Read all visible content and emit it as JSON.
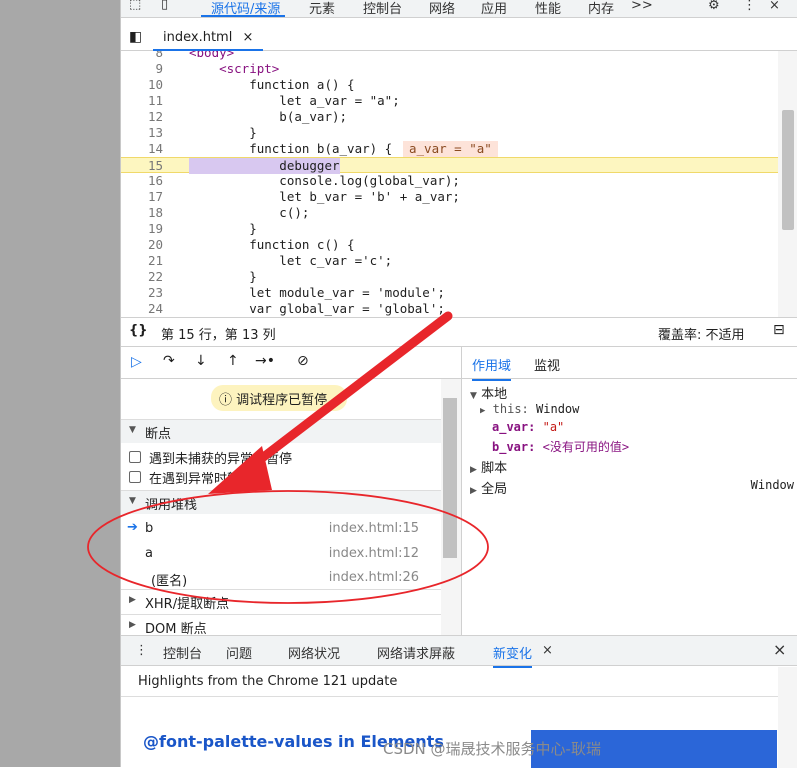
{
  "toptabs": [
    "源代码/来源",
    "元素",
    "控制台",
    "网络",
    "应用",
    "性能",
    "内存"
  ],
  "toptabs_more": ">>",
  "file_tab": "index.html",
  "close_char": "×",
  "code_lines": [
    {
      "n": "8",
      "t": "<body>"
    },
    {
      "n": "9",
      "t": "    <script>"
    },
    {
      "n": "10",
      "t": "        function a() {"
    },
    {
      "n": "11",
      "t": "            let a_var = \"a\";"
    },
    {
      "n": "12",
      "t": "            b(a_var);"
    },
    {
      "n": "13",
      "t": "        }"
    },
    {
      "n": "14",
      "t": "        function b(a_var) {"
    },
    {
      "n": "15",
      "t": "            debugger"
    },
    {
      "n": "16",
      "t": "            console.log(global_var);"
    },
    {
      "n": "17",
      "t": "            let b_var = 'b' + a_var;"
    },
    {
      "n": "18",
      "t": "            c();"
    },
    {
      "n": "19",
      "t": "        }"
    },
    {
      "n": "20",
      "t": "        function c() {"
    },
    {
      "n": "21",
      "t": "            let c_var ='c';"
    },
    {
      "n": "22",
      "t": "        }"
    },
    {
      "n": "23",
      "t": "        let module_var = 'module';"
    },
    {
      "n": "24",
      "t": "        var global_var = 'global';"
    }
  ],
  "inline_value": "a_var = \"a\"",
  "status": {
    "braces": "{}",
    "position": "第 15 行，第 13 列",
    "coverage": "覆盖率: 不适用"
  },
  "paused_msg": "调试程序已暂停",
  "sections": {
    "breakpoints": "断点",
    "bp_uncaught": "遇到未捕获的异常时暂停",
    "bp_caught": "在遇到异常时暂停",
    "callstack": "调用堆栈",
    "xhr": "XHR/提取断点",
    "dom": "DOM 断点"
  },
  "callstack": [
    {
      "name": "b",
      "file": "index.html:15"
    },
    {
      "name": "a",
      "file": "index.html:12"
    },
    {
      "name": "(匿名)",
      "file": "index.html:26"
    }
  ],
  "right_tabs": [
    "作用域",
    "监视"
  ],
  "scope": {
    "local": "本地",
    "this_key": "this:",
    "this_val": "Window",
    "a_key": "a_var:",
    "a_val": "\"a\"",
    "b_key": "b_var:",
    "b_val": "<没有可用的值>",
    "script": "脚本",
    "global": "全局",
    "global_val": "Window"
  },
  "drawer_tabs": [
    "控制台",
    "问题",
    "网络状况",
    "网络请求屏蔽",
    "新变化"
  ],
  "drawer_title": "Highlights from the Chrome 121 update",
  "drawer_heading": "@font-palette-values in Elements",
  "watermark": "CSDN @瑞晟技术服务中心-耿瑞",
  "colors": {
    "accent": "#1a73e8",
    "annotation_red": "#e8262b"
  }
}
